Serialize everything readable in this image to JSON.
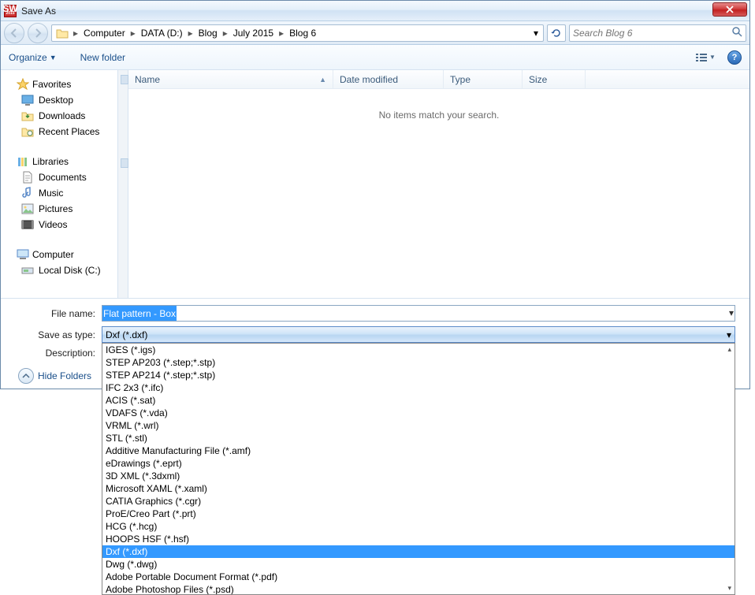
{
  "window": {
    "title": "Save As"
  },
  "breadcrumb": {
    "segments": [
      "Computer",
      "DATA (D:)",
      "Blog",
      "July 2015",
      "Blog 6"
    ]
  },
  "search": {
    "placeholder": "Search Blog 6"
  },
  "toolbar": {
    "organize": "Organize",
    "newfolder": "New folder"
  },
  "columns": {
    "name": "Name",
    "date": "Date modified",
    "type": "Type",
    "size": "Size"
  },
  "empty": "No items match your search.",
  "nav": {
    "favorites": {
      "label": "Favorites",
      "items": [
        "Desktop",
        "Downloads",
        "Recent Places"
      ]
    },
    "libraries": {
      "label": "Libraries",
      "items": [
        "Documents",
        "Music",
        "Pictures",
        "Videos"
      ]
    },
    "computer": {
      "label": "Computer",
      "items": [
        "Local Disk (C:)"
      ]
    }
  },
  "form": {
    "filename_label": "File name:",
    "filename_value": "Flat pattern - Box",
    "savetype_label": "Save as type:",
    "savetype_value": "Dxf (*.dxf)",
    "description_label": "Description:",
    "selected_index": 16,
    "options": [
      "IGES (*.igs)",
      "STEP AP203 (*.step;*.stp)",
      "STEP AP214 (*.step;*.stp)",
      "IFC 2x3 (*.ifc)",
      "ACIS (*.sat)",
      "VDAFS (*.vda)",
      "VRML (*.wrl)",
      "STL (*.stl)",
      "Additive Manufacturing File (*.amf)",
      "eDrawings (*.eprt)",
      "3D XML (*.3dxml)",
      "Microsoft XAML (*.xaml)",
      "CATIA Graphics (*.cgr)",
      "ProE/Creo Part (*.prt)",
      "HCG (*.hcg)",
      "HOOPS HSF (*.hsf)",
      "Dxf (*.dxf)",
      "Dwg (*.dwg)",
      "Adobe Portable Document Format (*.pdf)",
      "Adobe Photoshop Files (*.psd)"
    ]
  },
  "hide_folders": "Hide Folders"
}
